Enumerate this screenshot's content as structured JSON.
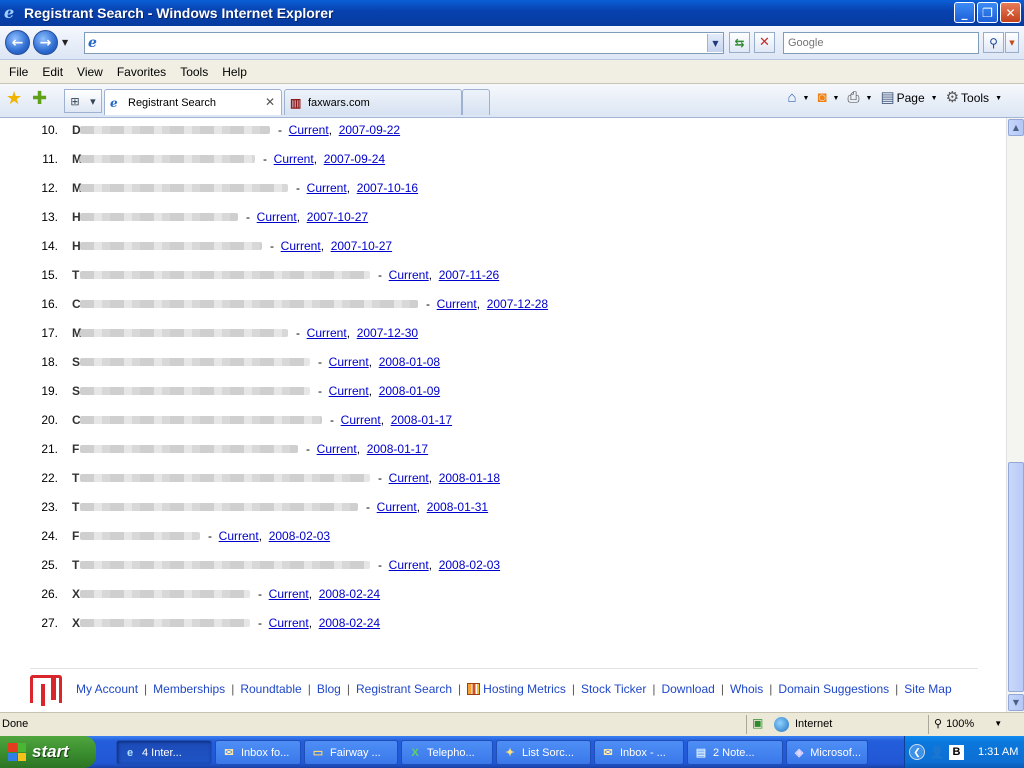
{
  "window": {
    "title": "Registrant Search - Windows Internet Explorer"
  },
  "address": {
    "url": "",
    "search_placeholder": "Google"
  },
  "menu": [
    "File",
    "Edit",
    "View",
    "Favorites",
    "Tools",
    "Help"
  ],
  "tabs": [
    {
      "label": "Registrant Search",
      "active": true
    },
    {
      "label": "faxwars.com",
      "active": false
    }
  ],
  "command_bar": {
    "page_label": "Page",
    "tools_label": "Tools"
  },
  "results": [
    {
      "n": "10.",
      "letter": "D",
      "status": "Current",
      "date": "2007-09-22",
      "blur": 190
    },
    {
      "n": "11.",
      "letter": "M",
      "status": "Current",
      "date": "2007-09-24",
      "blur": 175
    },
    {
      "n": "12.",
      "letter": "M",
      "status": "Current",
      "date": "2007-10-16",
      "blur": 208
    },
    {
      "n": "13.",
      "letter": "H",
      "status": "Current",
      "date": "2007-10-27",
      "blur": 158
    },
    {
      "n": "14.",
      "letter": "H",
      "status": "Current",
      "date": "2007-10-27",
      "blur": 182
    },
    {
      "n": "15.",
      "letter": "T",
      "status": "Current",
      "date": "2007-11-26",
      "blur": 290
    },
    {
      "n": "16.",
      "letter": "C",
      "status": "Current",
      "date": "2007-12-28",
      "blur": 338
    },
    {
      "n": "17.",
      "letter": "M",
      "status": "Current",
      "date": "2007-12-30",
      "blur": 208
    },
    {
      "n": "18.",
      "letter": "S",
      "status": "Current",
      "date": "2008-01-08",
      "blur": 230
    },
    {
      "n": "19.",
      "letter": "S",
      "status": "Current",
      "date": "2008-01-09",
      "blur": 230
    },
    {
      "n": "20.",
      "letter": "C",
      "status": "Current",
      "date": "2008-01-17",
      "blur": 242
    },
    {
      "n": "21.",
      "letter": "F",
      "status": "Current",
      "date": "2008-01-17",
      "blur": 218
    },
    {
      "n": "22.",
      "letter": "T",
      "status": "Current",
      "date": "2008-01-18",
      "blur": 290
    },
    {
      "n": "23.",
      "letter": "T",
      "status": "Current",
      "date": "2008-01-31",
      "blur": 278
    },
    {
      "n": "24.",
      "letter": "F",
      "status": "Current",
      "date": "2008-02-03",
      "blur": 120
    },
    {
      "n": "25.",
      "letter": "T",
      "status": "Current",
      "date": "2008-02-03",
      "blur": 290
    },
    {
      "n": "26.",
      "letter": "X",
      "status": "Current",
      "date": "2008-02-24",
      "blur": 170
    },
    {
      "n": "27.",
      "letter": "X",
      "status": "Current",
      "date": "2008-02-24",
      "blur": 170
    }
  ],
  "footer_links": [
    "My Account",
    "Memberships",
    "Roundtable",
    "Blog",
    "Registrant Search",
    "Hosting Metrics",
    "Stock Ticker",
    "Download",
    "Whois",
    "Domain Suggestions",
    "Site Map"
  ],
  "status": {
    "text": "Done",
    "zone": "Internet",
    "zoom": "100%"
  },
  "taskbar": {
    "start": "start",
    "tasks": [
      {
        "label": "4 Inter...",
        "icon": "ie-icon",
        "active": true,
        "w": 96
      },
      {
        "label": "Inbox fo...",
        "icon": "mail-icon",
        "active": false,
        "w": 86
      },
      {
        "label": "Fairway ...",
        "icon": "folder-icon",
        "active": false,
        "w": 94
      },
      {
        "label": "Telepho...",
        "icon": "excel-icon",
        "active": false,
        "w": 92
      },
      {
        "label": "List Sorc...",
        "icon": "wand-icon",
        "active": false,
        "w": 95
      },
      {
        "label": "Inbox - ...",
        "icon": "mail-icon",
        "active": false,
        "w": 90
      },
      {
        "label": "2 Note...",
        "icon": "notepad-icon",
        "active": false,
        "w": 96
      },
      {
        "label": "Microsof...",
        "icon": "app-icon",
        "active": false,
        "w": 82
      }
    ],
    "clock": "1:31 AM"
  },
  "colors": {
    "link": "#0000cc",
    "titlebar": "#0842b0",
    "taskbar": "#245edc",
    "start": "#3b8f2f"
  }
}
